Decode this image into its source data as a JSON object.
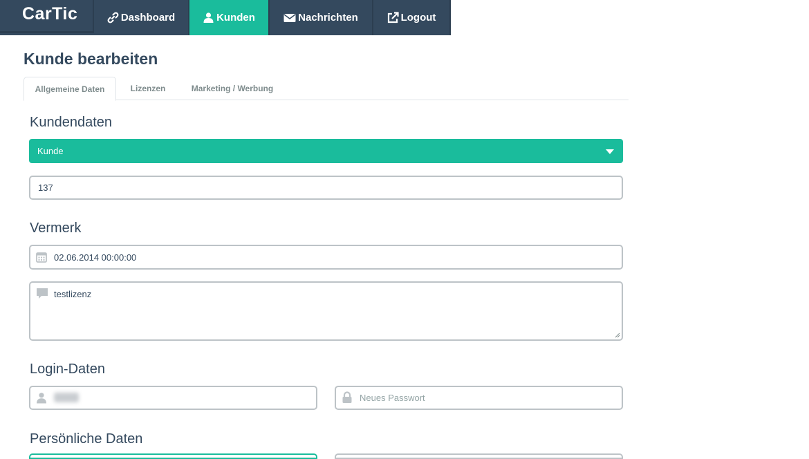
{
  "navbar": {
    "brand": "CarTic",
    "items": [
      {
        "label": "Dashboard",
        "icon": "link-icon",
        "active": false
      },
      {
        "label": "Kunden",
        "icon": "user-icon",
        "active": true
      },
      {
        "label": "Nachrichten",
        "icon": "envelope-icon",
        "active": false
      },
      {
        "label": "Logout",
        "icon": "external-link-icon",
        "active": false
      }
    ]
  },
  "page": {
    "title": "Kunde bearbeiten",
    "tabs": [
      {
        "label": "Allgemeine Daten",
        "active": true
      },
      {
        "label": "Lizenzen",
        "active": false
      },
      {
        "label": "Marketing / Werbung",
        "active": false
      }
    ]
  },
  "kundendaten": {
    "heading": "Kundendaten",
    "type_select": "Kunde",
    "customer_number": "137"
  },
  "vermerk": {
    "heading": "Vermerk",
    "date": "02.06.2014 00:00:00",
    "note": "testlizenz"
  },
  "login": {
    "heading": "Login-Daten",
    "username": "",
    "password_placeholder": "Neues Passwort"
  },
  "persoenlich": {
    "heading": "Persönliche Daten"
  },
  "colors": {
    "navbar": "#34495e",
    "accent": "#1abc9c",
    "border": "#bdc3c7"
  }
}
